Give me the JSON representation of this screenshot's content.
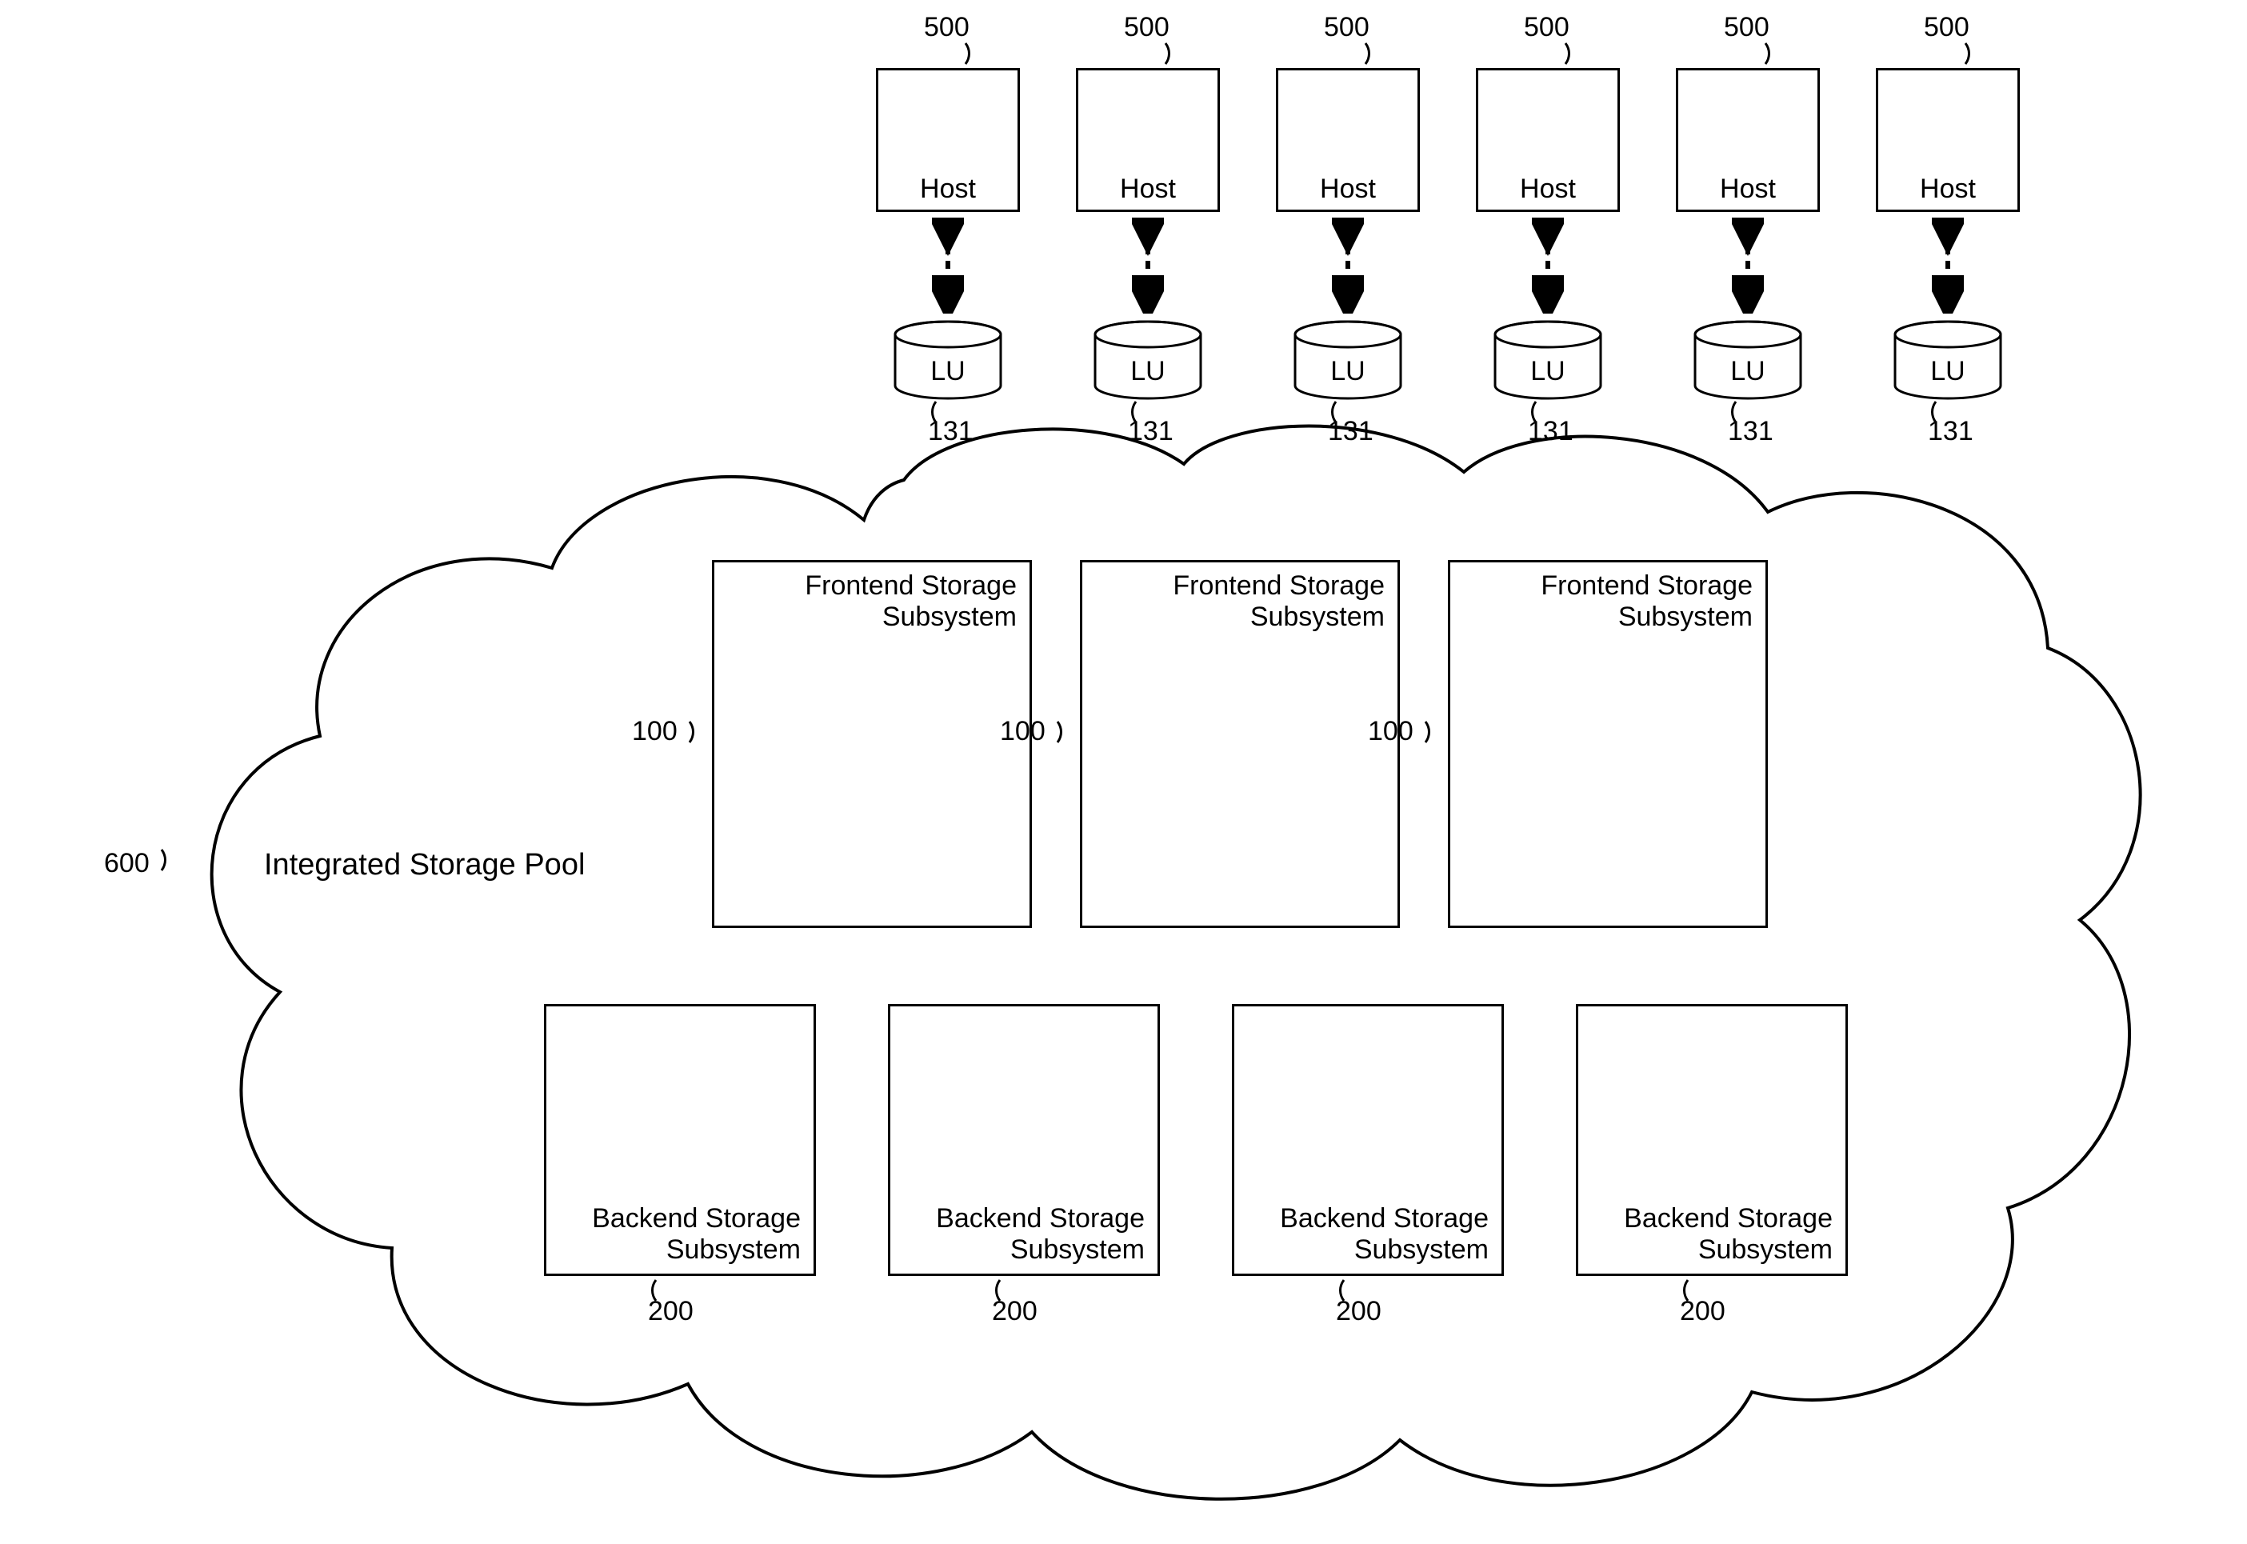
{
  "hosts": {
    "label": "Host",
    "ref": "500",
    "count": 6
  },
  "lu": {
    "label": "LU",
    "ref": "131",
    "count": 6
  },
  "frontend": {
    "label": "Frontend Storage Subsystem",
    "ref": "100",
    "count": 3
  },
  "backend": {
    "label": "Backend Storage Subsystem",
    "ref": "200",
    "count": 4
  },
  "pool": {
    "label": "Integrated Storage Pool",
    "ref": "600"
  }
}
